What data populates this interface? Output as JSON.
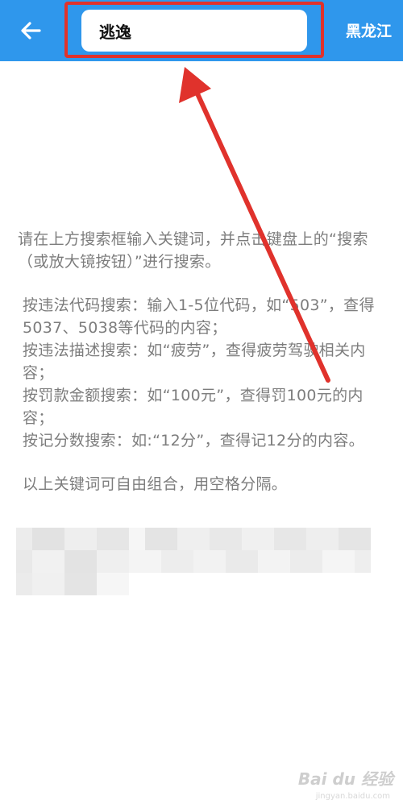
{
  "header": {
    "search_value": "逃逸",
    "province_label": "黑龙江"
  },
  "instructions": {
    "intro": "请在上方搜索框输入关键词，并点击键盘上的“搜索（或放大镜按钮）”进行搜索。",
    "rule_code": "按违法代码搜索：输入1-5位代码，如“503”，查得5037、5038等代码的内容；",
    "rule_description": "按违法描述搜索：如“疲劳”，查得疲劳驾驶相关内容；",
    "rule_fine": "按罚款金额搜索：如“100元”，查得罚100元的内容；",
    "rule_points": "按记分数搜索：如:“12分”，查得记12分的内容。",
    "combine_note": "以上关键词可自由组合，用空格分隔。"
  },
  "watermark": {
    "brand": "Bai du 经验",
    "sub": "jingyan.baidu.com"
  },
  "colors": {
    "topbar": "#2f97ec",
    "highlight": "#e0322c",
    "text": "#7d7d7d"
  },
  "icons": {
    "back": "arrow-left-icon"
  }
}
